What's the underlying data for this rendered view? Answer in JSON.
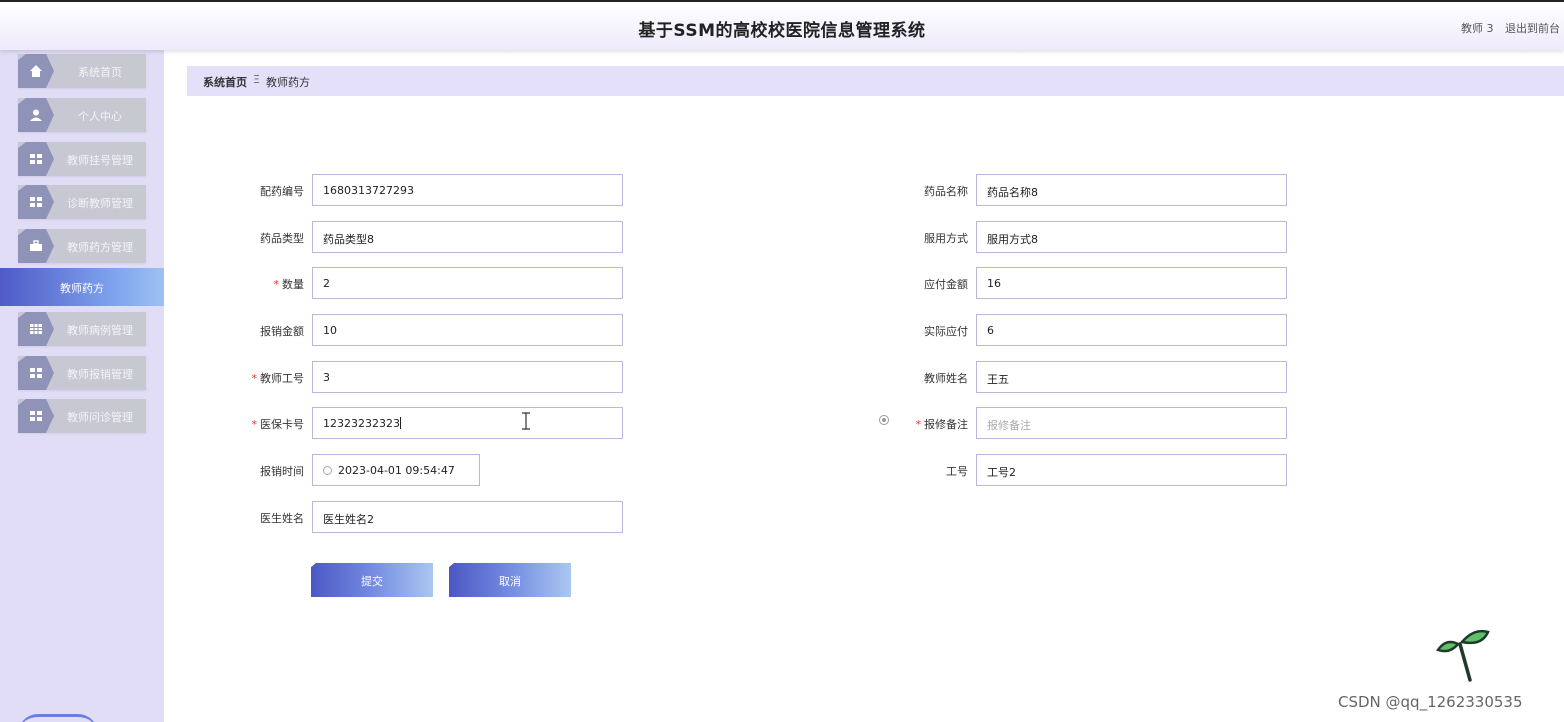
{
  "header": {
    "title": "基于SSM的高校校医院信息管理系统",
    "user": "教师 3",
    "logout": "退出到前台"
  },
  "sidebar": {
    "items": [
      {
        "label": "系统首页",
        "icon": "home-icon"
      },
      {
        "label": "个人中心",
        "icon": "user-icon"
      },
      {
        "label": "教师挂号管理",
        "icon": "grid-icon"
      },
      {
        "label": "诊断教师管理",
        "icon": "grid-icon"
      },
      {
        "label": "教师药方管理",
        "icon": "briefcase-icon"
      },
      {
        "label": "教师病例管理",
        "icon": "table-icon"
      },
      {
        "label": "教师报销管理",
        "icon": "grid-icon"
      },
      {
        "label": "教师问诊管理",
        "icon": "grid-icon"
      }
    ],
    "active_sub": "教师药方"
  },
  "breadcrumb": {
    "home": "系统首页",
    "separator": "Ξ",
    "current": "教师药方"
  },
  "form": {
    "left": [
      {
        "label": "配药编号",
        "value": "1680313727293",
        "required": false
      },
      {
        "label": "药品类型",
        "value": "药品类型8",
        "required": false
      },
      {
        "label": "数量",
        "value": "2",
        "required": true
      },
      {
        "label": "报销金额",
        "value": "10",
        "required": false
      },
      {
        "label": "教师工号",
        "value": "3",
        "required": true
      },
      {
        "label": "医保卡号",
        "value": "12323232323",
        "required": true
      },
      {
        "label": "报销时间",
        "value": "2023-04-01 09:54:47",
        "required": false
      },
      {
        "label": "医生姓名",
        "value": "医生姓名2",
        "required": false
      }
    ],
    "right": [
      {
        "label": "药品名称",
        "value": "药品名称8",
        "required": false
      },
      {
        "label": "服用方式",
        "value": "服用方式8",
        "required": false
      },
      {
        "label": "应付金额",
        "value": "16",
        "required": false
      },
      {
        "label": "实际应付",
        "value": "6",
        "required": false
      },
      {
        "label": "教师姓名",
        "value": "王五",
        "required": false
      },
      {
        "label": "报修备注",
        "value": "",
        "placeholder": "报修备注",
        "required": true
      },
      {
        "label": "工号",
        "value": "工号2",
        "required": false
      }
    ],
    "required_mark": "*",
    "submit": "提交",
    "cancel": "取消"
  },
  "watermark": "CSDN @qq_1262330535",
  "colors": {
    "accent": "#4f5ac7",
    "sidebar_bg": "#e2ddf7",
    "breadcrumb_bg": "#e4e0fa",
    "required": "#ee3333"
  }
}
